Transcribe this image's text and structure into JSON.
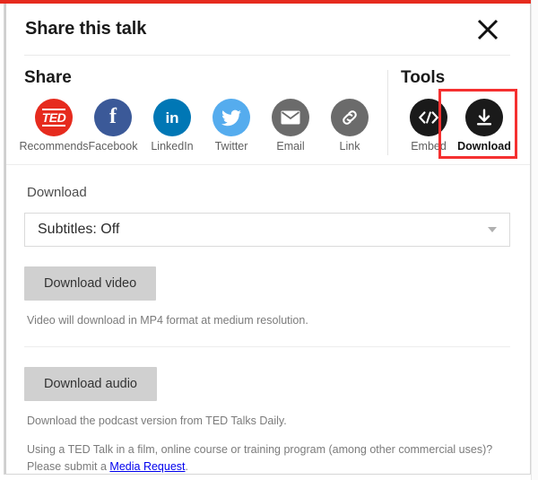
{
  "modal": {
    "title": "Share this talk",
    "close_icon": "close-icon"
  },
  "share": {
    "heading": "Share",
    "items": [
      {
        "label": "Recommends",
        "icon": "ted-recommends-icon",
        "glyph": "TED",
        "color": "#e62b1e"
      },
      {
        "label": "Facebook",
        "icon": "facebook-icon",
        "glyph": "f",
        "color": "#3b5998"
      },
      {
        "label": "LinkedIn",
        "icon": "linkedin-icon",
        "glyph": "in",
        "color": "#0077b5"
      },
      {
        "label": "Twitter",
        "icon": "twitter-icon",
        "glyph": "bird",
        "color": "#55acee"
      },
      {
        "label": "Email",
        "icon": "email-icon",
        "glyph": "envelope",
        "color": "#6b6b6b"
      },
      {
        "label": "Link",
        "icon": "link-icon",
        "glyph": "chain",
        "color": "#6b6b6b"
      }
    ]
  },
  "tools": {
    "heading": "Tools",
    "items": [
      {
        "label": "Embed",
        "icon": "embed-code-icon",
        "color": "#1a1a1a",
        "highlighted": false
      },
      {
        "label": "Download",
        "icon": "download-icon",
        "color": "#1a1a1a",
        "highlighted": true
      }
    ],
    "annotation_color": "#f53030"
  },
  "download": {
    "section_label": "Download",
    "subtitles_select": {
      "value": "Subtitles: Off",
      "options": [
        "Subtitles: Off"
      ]
    },
    "video_button": "Download video",
    "video_helper": "Video will download in MP4 format at medium resolution.",
    "audio_button": "Download audio",
    "audio_helper": "Download the podcast version from TED Talks Daily.",
    "legal_text_before": "Using a TED Talk in a film, online course or training program (among other commercial uses)? Please submit a ",
    "legal_link": "Media Request",
    "legal_text_after": "."
  }
}
